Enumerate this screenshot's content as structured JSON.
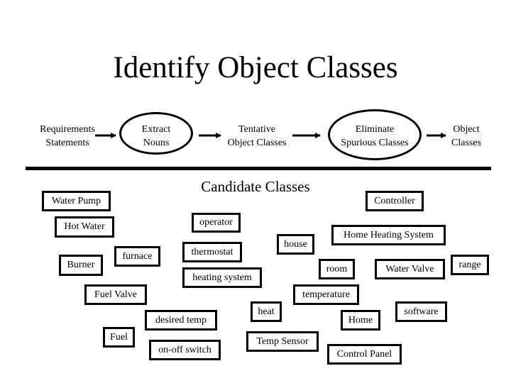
{
  "title": "Identify Object Classes",
  "process": {
    "steps": [
      {
        "line1": "Requirements",
        "line2": "Statements",
        "shape": "text"
      },
      {
        "line1": "Extract",
        "line2": "Nouns",
        "shape": "ellipse"
      },
      {
        "line1": "Tentative",
        "line2": "Object Classes",
        "shape": "text"
      },
      {
        "line1": "Eliminate",
        "line2": "Spurious Classes",
        "shape": "ellipse"
      },
      {
        "line1": "Object",
        "line2": "Classes",
        "shape": "text"
      }
    ]
  },
  "candidates": {
    "heading": "Candidate Classes",
    "items": [
      "Water Pump",
      "Hot Water",
      "Burner",
      "furnace",
      "operator",
      "thermostat",
      "heating system",
      "house",
      "Controller",
      "Home Heating System",
      "room",
      "Water Valve",
      "range",
      "Fuel Valve",
      "temperature",
      "heat",
      "desired temp",
      "Home",
      "software",
      "Fuel",
      "on-off switch",
      "Temp Sensor",
      "Control Panel"
    ]
  }
}
